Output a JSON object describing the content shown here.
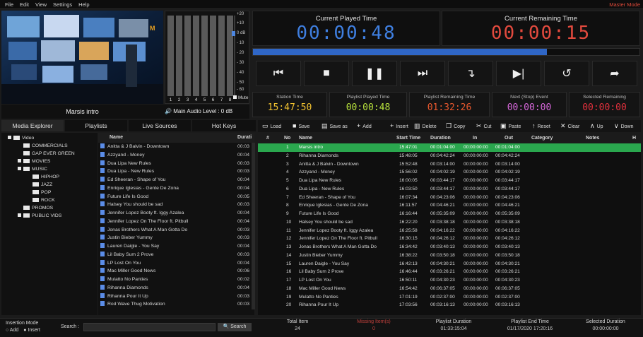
{
  "menu": {
    "items": [
      "File",
      "Edit",
      "View",
      "Settings",
      "Help"
    ],
    "mode": "Master Mode"
  },
  "preview": {
    "title": "Marsis intro",
    "audio_level": "Main Audio Level : 0 dB"
  },
  "vu": {
    "channels": [
      "1",
      "2",
      "3",
      "4",
      "5",
      "6",
      "7",
      "8"
    ],
    "mute": "Mute",
    "scale": [
      "+20",
      "+10",
      "0 dB",
      "- 10",
      "- 20",
      "- 30",
      "- 40",
      "- 50",
      "- 60"
    ]
  },
  "times": {
    "played_label": "Current Played Time",
    "played": "00:00:48",
    "remaining_label": "Current Remaining Time",
    "remaining": "00:00:15",
    "progress": 0.76
  },
  "transport": [
    "previous",
    "stop",
    "pause",
    "next",
    "jump",
    "play-next",
    "repeat",
    "forward"
  ],
  "stats": [
    {
      "label": "Station Time",
      "value": "15:47:50",
      "color": "#f2c230"
    },
    {
      "label": "Playlist Played Time",
      "value": "00:00:48",
      "color": "#b6e03c"
    },
    {
      "label": "Playlist Remaining Time",
      "value": "01:32:26",
      "color": "#e8582e"
    },
    {
      "label": "Next (Stop) Event",
      "value": "00:00:00",
      "color": "#d466d8"
    },
    {
      "label": "Selected Remaining",
      "value": "00:00:00",
      "color": "#e0303c"
    }
  ],
  "tabs": [
    "Media Explorer",
    "Playlists",
    "Live Sources",
    "Hot Keys"
  ],
  "tree": [
    {
      "label": "Video",
      "level": 0,
      "exp": true
    },
    {
      "label": "COMMERCIALS",
      "level": 1
    },
    {
      "label": "GAP EVER GREEN",
      "level": 1
    },
    {
      "label": "MOVIES",
      "level": 1,
      "exp": true
    },
    {
      "label": "MUSIC",
      "level": 1,
      "exp": true
    },
    {
      "label": "HIPHOP",
      "level": 2
    },
    {
      "label": "JAZZ",
      "level": 2
    },
    {
      "label": "POP",
      "level": 2
    },
    {
      "label": "ROCK",
      "level": 2
    },
    {
      "label": "PROMOS",
      "level": 1
    },
    {
      "label": "PUBLIC VIDS",
      "level": 1,
      "exp": true
    }
  ],
  "files": {
    "headers": {
      "name": "Name",
      "duration": "Durati"
    },
    "rows": [
      {
        "name": "Anitta & J Balvin - Downtown",
        "d": "00:03"
      },
      {
        "name": "Azzyand - Money",
        "d": "00:04"
      },
      {
        "name": "Dua Lipa  New Rules",
        "d": "00:03"
      },
      {
        "name": "Dua Lipa - New Rules",
        "d": "00:03"
      },
      {
        "name": "Ed Sheeran - Shape of You",
        "d": "00:04"
      },
      {
        "name": "Enrique Iglesias - Gente De Zona",
        "d": "00:04"
      },
      {
        "name": "Future  Life Is Good",
        "d": "00:05"
      },
      {
        "name": "Halsey  You should be sad",
        "d": "00:03"
      },
      {
        "name": "Jennifer Lopez  Booty ft. Iggy Azalea",
        "d": "00:04"
      },
      {
        "name": "Jennifer Lopez  On The Floor ft. Pitbull",
        "d": "00:04"
      },
      {
        "name": "Jonas Brothers  What A Man Gotta Do",
        "d": "00:03"
      },
      {
        "name": "Justin Bieber  Yummy",
        "d": "00:03"
      },
      {
        "name": "Lauren Daigle - You Say",
        "d": "00:04"
      },
      {
        "name": "Lil Baby  Sum 2 Prove",
        "d": "00:03"
      },
      {
        "name": "LP  Lost On You",
        "d": "00:04"
      },
      {
        "name": "Mac Miller  Good News",
        "d": "00:06"
      },
      {
        "name": "Mulatto No Panties",
        "d": "00:02"
      },
      {
        "name": "Rihanna  Diamonds",
        "d": "00:04"
      },
      {
        "name": "Rihanna  Pour It Up",
        "d": "00:03"
      },
      {
        "name": "Rod Wave  Thug Motivation",
        "d": "00:03"
      }
    ]
  },
  "toolbar": [
    {
      "icon": "▭",
      "label": "Load"
    },
    {
      "icon": "■",
      "label": "Save"
    },
    {
      "icon": "▤",
      "label": "Save as"
    },
    {
      "icon": "+",
      "label": "Add"
    },
    {
      "icon": "+",
      "label": "Insert"
    },
    {
      "icon": "▥",
      "label": "Delete"
    },
    {
      "icon": "❐",
      "label": "Copy"
    },
    {
      "icon": "✂",
      "label": "Cut"
    },
    {
      "icon": "▣",
      "label": "Paste"
    },
    {
      "icon": "↑",
      "label": "Reset"
    },
    {
      "icon": "✕",
      "label": "Clear"
    },
    {
      "icon": "∧",
      "label": "Up"
    },
    {
      "icon": "∨",
      "label": "Down"
    }
  ],
  "playlist": {
    "headers": [
      "#",
      "No",
      "Name",
      "Start Time",
      "Duration",
      "In",
      "Out",
      "Category",
      "Notes",
      "H"
    ],
    "rows": [
      {
        "no": "1",
        "name": "Marsis intro",
        "start": "15:47:01",
        "dur": "00:01:04:00",
        "in": "00:00:00:00",
        "out": "00:01:04:00"
      },
      {
        "no": "2",
        "name": "Rihanna  Diamonds",
        "start": "15:48:05",
        "dur": "00:04:42:24",
        "in": "00:00:00:00",
        "out": "00:04:42:24"
      },
      {
        "no": "3",
        "name": "Anitta & J Balvin - Downtown",
        "start": "15:52:48",
        "dur": "00:03:14:00",
        "in": "00:00:00:00",
        "out": "00:03:14:00"
      },
      {
        "no": "4",
        "name": "Azzyand - Money",
        "start": "15:56:02",
        "dur": "00:04:02:19",
        "in": "00:00:00:00",
        "out": "00:04:02:19"
      },
      {
        "no": "5",
        "name": "Dua Lipa  New Rules",
        "start": "16:00:05",
        "dur": "00:03:44:17",
        "in": "00:00:00:00",
        "out": "00:03:44:17"
      },
      {
        "no": "6",
        "name": "Dua Lipa - New Rules",
        "start": "16:03:50",
        "dur": "00:03:44:17",
        "in": "00:00:00:00",
        "out": "00:03:44:17"
      },
      {
        "no": "7",
        "name": "Ed Sheeran - Shape of You",
        "start": "16:07:34",
        "dur": "00:04:23:06",
        "in": "00:00:00:00",
        "out": "00:04:23:06"
      },
      {
        "no": "8",
        "name": "Enrique Iglesias - Gente De Zona",
        "start": "16:11:57",
        "dur": "00:04:46:21",
        "in": "00:00:00:00",
        "out": "00:04:46:21"
      },
      {
        "no": "9",
        "name": "Future  Life Is Good",
        "start": "16:16:44",
        "dur": "00:05:35:09",
        "in": "00:00:00:00",
        "out": "00:05:35:09"
      },
      {
        "no": "10",
        "name": "Halsey  You should be sad",
        "start": "16:22:20",
        "dur": "00:03:38:18",
        "in": "00:00:00:00",
        "out": "00:03:38:18"
      },
      {
        "no": "11",
        "name": "Jennifer Lopez  Booty ft. Iggy Azalea",
        "start": "16:25:58",
        "dur": "00:04:16:22",
        "in": "00:00:00:00",
        "out": "00:04:16:22"
      },
      {
        "no": "12",
        "name": "Jennifer Lopez  On The Floor ft. Pitbull",
        "start": "16:30:15",
        "dur": "00:04:26:12",
        "in": "00:00:00:00",
        "out": "00:04:26:12"
      },
      {
        "no": "13",
        "name": "Jonas Brothers  What A Man Gotta Do",
        "start": "16:34:42",
        "dur": "00:03:40:13",
        "in": "00:00:00:00",
        "out": "00:03:40:13"
      },
      {
        "no": "14",
        "name": "Justin Bieber  Yummy",
        "start": "16:38:22",
        "dur": "00:03:50:18",
        "in": "00:00:00:00",
        "out": "00:03:50:18"
      },
      {
        "no": "15",
        "name": "Lauren Daigle - You Say",
        "start": "16:42:13",
        "dur": "00:04:30:21",
        "in": "00:00:00:00",
        "out": "00:04:30:21"
      },
      {
        "no": "16",
        "name": "Lil Baby  Sum 2 Prove",
        "start": "16:46:44",
        "dur": "00:03:26:21",
        "in": "00:00:00:00",
        "out": "00:03:26:21"
      },
      {
        "no": "17",
        "name": "LP  Lost On You",
        "start": "16:50:11",
        "dur": "00:04:30:23",
        "in": "00:00:00:00",
        "out": "00:04:30:23"
      },
      {
        "no": "18",
        "name": "Mac Miller  Good News",
        "start": "16:54:42",
        "dur": "00:06:37:05",
        "in": "00:00:00:00",
        "out": "00:06:37:05"
      },
      {
        "no": "19",
        "name": "Mulatto No Panties",
        "start": "17:01:19",
        "dur": "00:02:37:00",
        "in": "00:00:00:00",
        "out": "00:02:37:00"
      },
      {
        "no": "20",
        "name": "Rihanna  Pour It Up",
        "start": "17:03:56",
        "dur": "00:03:16:13",
        "in": "00:00:00:00",
        "out": "00:03:16:13"
      }
    ]
  },
  "insertion": {
    "label": "Insertion Mode",
    "add": "Add",
    "insert": "Insert",
    "search_label": "Search :",
    "search_btn": "Search"
  },
  "footer": [
    {
      "label": "Total Item",
      "value": "24",
      "color": "#d0d0d0"
    },
    {
      "label": "Missing Item(s)",
      "value": "0",
      "color": "#c0403c"
    },
    {
      "label": "Playlist Duration",
      "value": "01:33:15:04",
      "color": "#d0d0d0"
    },
    {
      "label": "Playlist End Time",
      "value": "01/17/2020 17:20:16",
      "color": "#d0d0d0"
    },
    {
      "label": "Selected Duration",
      "value": "00:00:00:00",
      "color": "#d0d0d0"
    }
  ]
}
